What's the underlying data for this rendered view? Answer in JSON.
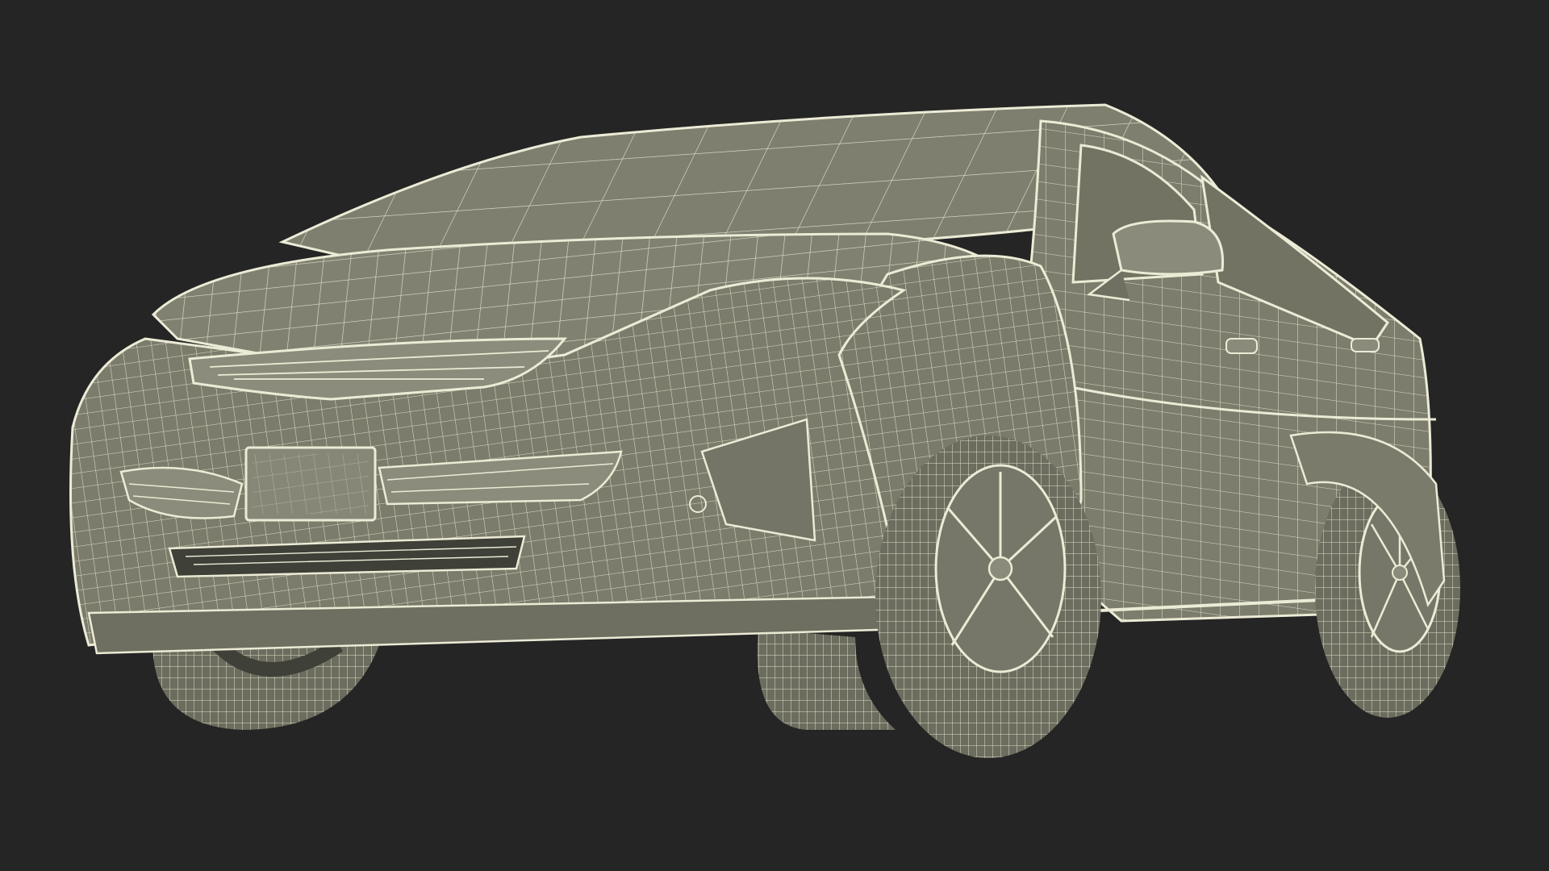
{
  "scene": {
    "subject": "car-wireframe-render",
    "colors": {
      "background": "#252525",
      "surface": "#7c7d6c",
      "surface_dark": "#5e5f52",
      "surface_light": "#8f9080",
      "wire": "#ecebd6",
      "cavity": "#3f4038"
    }
  }
}
